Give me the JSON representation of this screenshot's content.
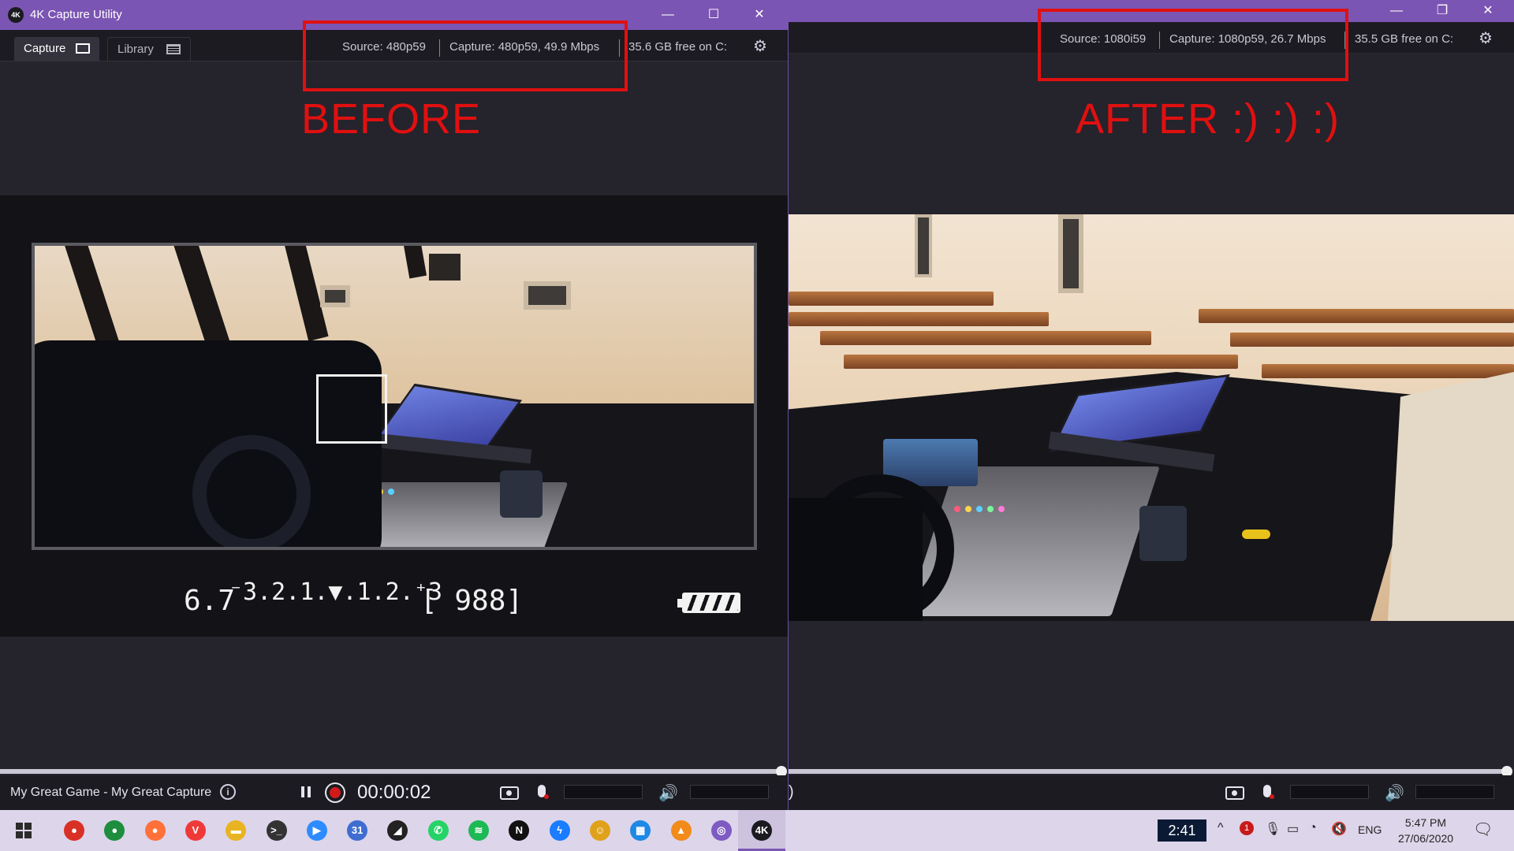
{
  "app": {
    "title": "4K Capture Utility",
    "logo_text": "4K",
    "accent_color": "#7b55b3"
  },
  "window_controls": {
    "minimize": "—",
    "maximize": "☐",
    "restore": "❐",
    "close": "✕"
  },
  "tabs": [
    {
      "label": "Capture",
      "icon": "monitor-icon",
      "active": true
    },
    {
      "label": "Library",
      "icon": "grid-list-icon",
      "active": false
    }
  ],
  "before": {
    "source": "Source: 480p59",
    "capture": "Capture: 480p59, 49.9 Mbps",
    "disk": "35.6 GB free on C:",
    "annotation": "BEFORE",
    "hud": {
      "exposure_value": "6.7",
      "exposure_scale": "⁻3.2.1.▼.1.2.⁺3",
      "shots_remaining": "[  988]"
    }
  },
  "after": {
    "source": "Source: 1080i59",
    "capture": "Capture: 1080p59, 26.7 Mbps",
    "disk": "35.5 GB free on C:",
    "annotation": "AFTER :) :) :)"
  },
  "footer": {
    "capture_name": "My Great Game - My Great Capture",
    "info_icon": "i",
    "timer": "00:00:02",
    "cut_char": ")",
    "speaker": "🔊"
  },
  "taskbar": {
    "apps": [
      {
        "name": "chrome-icon",
        "color": "#d93025",
        "label": "●"
      },
      {
        "name": "chrome-alt-icon",
        "color": "#1e8e3e",
        "label": "●"
      },
      {
        "name": "firefox-icon",
        "color": "#ff7139",
        "label": "●"
      },
      {
        "name": "vivaldi-icon",
        "color": "#ef3939",
        "label": "V"
      },
      {
        "name": "file-explorer-icon",
        "color": "#e8b422",
        "label": "▬"
      },
      {
        "name": "terminal-icon",
        "color": "#333333",
        "label": ">_"
      },
      {
        "name": "zoom-icon",
        "color": "#2d8cff",
        "label": "▶"
      },
      {
        "name": "calendar-icon",
        "color": "#3f6dd1",
        "label": "31"
      },
      {
        "name": "sticky-notes-icon",
        "color": "#222222",
        "label": "◢"
      },
      {
        "name": "whatsapp-icon",
        "color": "#25d366",
        "label": "✆"
      },
      {
        "name": "spotify-icon",
        "color": "#1db954",
        "label": "≋"
      },
      {
        "name": "notion-icon",
        "color": "#111111",
        "label": "N"
      },
      {
        "name": "messenger-icon",
        "color": "#1a7cff",
        "label": "ϟ"
      },
      {
        "name": "bee-icon",
        "color": "#e0a21b",
        "label": "☺"
      },
      {
        "name": "windows-store-icon",
        "color": "#1e88e5",
        "label": "▦"
      },
      {
        "name": "orange-app-icon",
        "color": "#f28b1a",
        "label": "▲"
      },
      {
        "name": "purple-app-icon",
        "color": "#7d5bc2",
        "label": "◎"
      },
      {
        "name": "4k-capture-icon",
        "color": "#1b1a20",
        "label": "4K",
        "active": true
      }
    ],
    "tray_time_box": "2:41",
    "notification_count": "1",
    "chevron": "^",
    "language": "ENG",
    "clock_time": "5:47 PM",
    "clock_date": "27/06/2020"
  }
}
